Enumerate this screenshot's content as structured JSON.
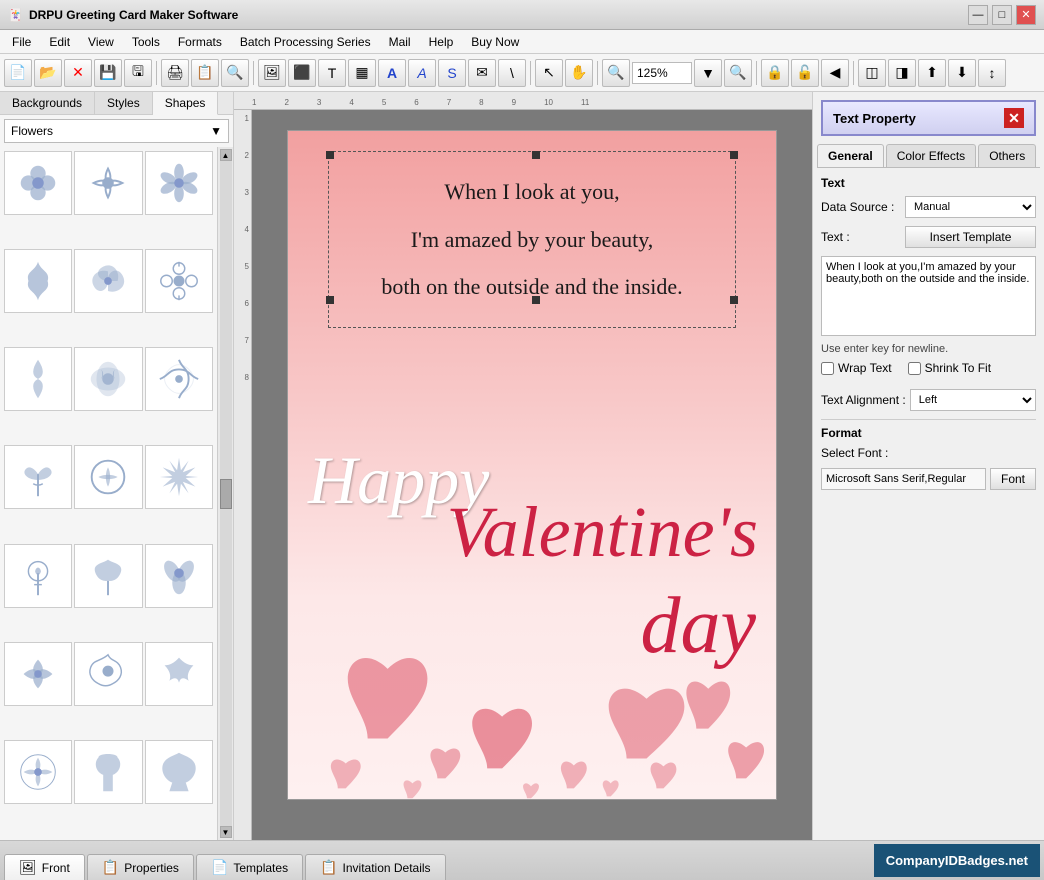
{
  "app": {
    "title": "DRPU Greeting Card Maker Software",
    "icon": "🃏"
  },
  "title_buttons": {
    "minimize": "—",
    "maximize": "□",
    "close": "✕"
  },
  "menu": {
    "items": [
      "File",
      "Edit",
      "View",
      "Tools",
      "Formats",
      "Batch Processing Series",
      "Mail",
      "Help",
      "Buy Now"
    ]
  },
  "toolbar": {
    "zoom_value": "125%"
  },
  "left_panel": {
    "tabs": [
      "Backgrounds",
      "Styles",
      "Shapes"
    ],
    "active_tab": "Shapes",
    "category": "Flowers",
    "dropdown_arrow": "▼"
  },
  "canvas": {
    "card": {
      "text_line1": "When I look at you,",
      "text_line2": "I'm amazed by your beauty,",
      "text_line3": "both on the outside and the inside.",
      "happy_text": "Happy",
      "valentines_text": "Valentine's",
      "day_text": "day"
    }
  },
  "right_panel": {
    "header": "Text Property",
    "close_icon": "✕",
    "tabs": [
      "General",
      "Color Effects",
      "Others"
    ],
    "active_tab": "General",
    "text_section_label": "Text",
    "data_source_label": "Data Source :",
    "data_source_value": "Manual",
    "text_label": "Text :",
    "insert_template_btn": "Insert Template",
    "textarea_content": "When I look at you,I'm amazed by your beauty,both on the outside and the inside.",
    "hint": "Use enter key for newline.",
    "wrap_text_label": "Wrap Text",
    "shrink_to_fit_label": "Shrink To Fit",
    "text_alignment_label": "Text Alignment :",
    "text_alignment_value": "Left",
    "format_label": "Format",
    "select_font_label": "Select Font :",
    "font_value": "Microsoft Sans Serif,Regular",
    "font_btn": "Font"
  },
  "bottom_tabs": {
    "items": [
      {
        "label": "Front",
        "icon": "🖼"
      },
      {
        "label": "Properties",
        "icon": "📋"
      },
      {
        "label": "Templates",
        "icon": "📄"
      },
      {
        "label": "Invitation Details",
        "icon": "📋"
      }
    ],
    "active": "Front",
    "company_badge": "CompanyIDBadges.net"
  }
}
